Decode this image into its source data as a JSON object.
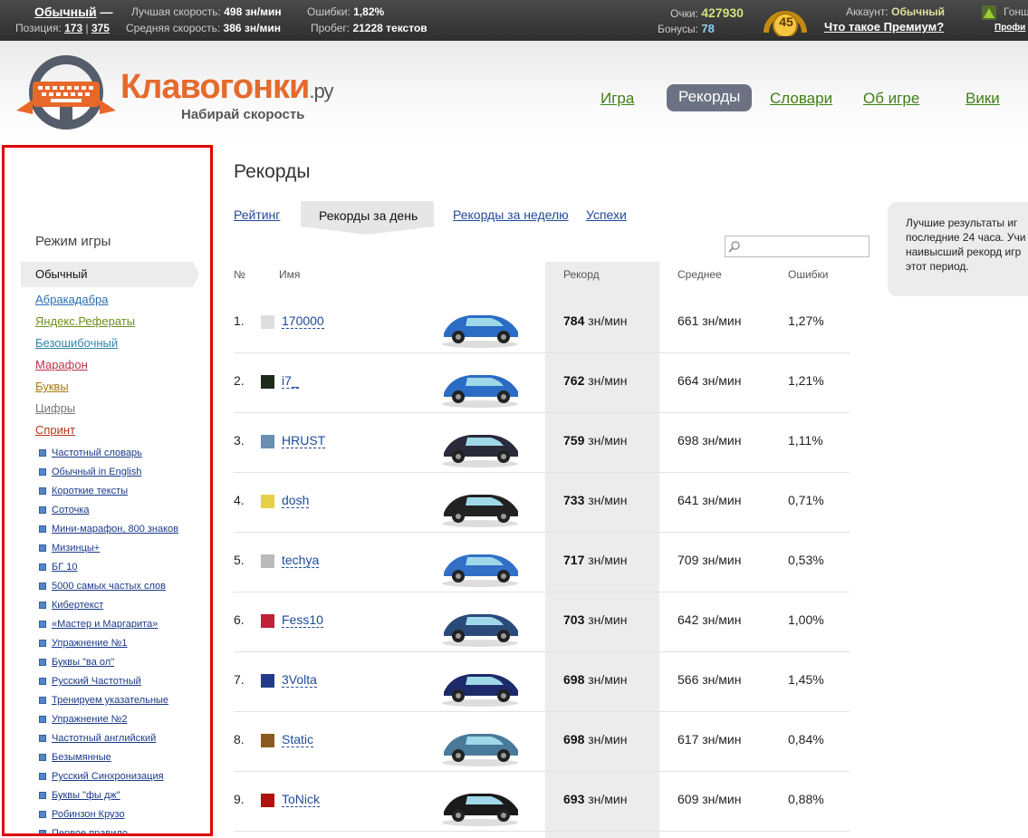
{
  "topbar": {
    "mode": "Обычный",
    "mode_dash": "—",
    "position_label": "Позиция:",
    "position_value": "173",
    "position_total": "375",
    "best_speed_label": "Лучшая скорость:",
    "best_speed_value": "498 зн/мин",
    "avg_speed_label": "Средняя скорость:",
    "avg_speed_value": "386 зн/мин",
    "errors_label": "Ошибки:",
    "errors_value": "1,82%",
    "mileage_label": "Пробег:",
    "mileage_value": "21228 текстов",
    "points_label": "Очки:",
    "points_value": "427930",
    "bonus_label": "Бонусы:",
    "bonus_value": "78",
    "level": "45",
    "account_label": "Аккаунт:",
    "account_value": "Обычный",
    "premium_link": "Что такое Премиум?",
    "user_short": "Гонщ",
    "profile_short": "Профи"
  },
  "header": {
    "brand": "Клавогонки",
    "brand_suffix": ".ру",
    "slogan": "Набирай скорость",
    "nav": [
      "Игра",
      "Рекорды",
      "Словари",
      "Об игре",
      "Вики"
    ],
    "active_nav": "Рекорды"
  },
  "sidebar": {
    "title": "Режим игры",
    "active": "Обычный",
    "modes": [
      {
        "label": "Абракадабра",
        "color": "#2a6fb0"
      },
      {
        "label": "Яндекс.Рефераты",
        "color": "#6f8f1e"
      },
      {
        "label": "Безошибочный",
        "color": "#2f86a8"
      },
      {
        "label": "Марафон",
        "color": "#c0304a"
      },
      {
        "label": "Буквы",
        "color": "#a87a10"
      },
      {
        "label": "Цифры",
        "color": "#777777"
      },
      {
        "label": "Спринт",
        "color": "#b23a1a"
      }
    ],
    "sub": [
      "Частотный словарь",
      "Обычный in English",
      "Короткие тексты",
      "Соточка",
      "Мини-марафон, 800 знаков",
      "Мизинцы+",
      "БГ 10",
      "5000 самых частых слов",
      "Кибертекст",
      "«Мастер и Маргарита»",
      "Упражнение №1",
      "Буквы \"ва ол\"",
      "Русский Частотный",
      "Тренируем указательные",
      "Упражнение №2",
      "Частотный английский",
      "Безымянные",
      "Русский Синхронизация",
      "Буквы \"фы дж\"",
      "Робинзон Крузо",
      "Первое правило"
    ]
  },
  "main": {
    "title": "Рекорды",
    "tabs": [
      "Рейтинг",
      "Рекорды за день",
      "Рекорды за неделю",
      "Успехи"
    ],
    "active_tab": "Рекорды за день",
    "columns": {
      "num": "№",
      "name": "Имя",
      "record": "Рекорд",
      "avg": "Среднее",
      "errors": "Ошибки"
    },
    "unit": "зн/мин",
    "rows": [
      {
        "num": "1.",
        "name": "170000",
        "record": "784",
        "avg": "661 зн/мин",
        "errors": "1,27%"
      },
      {
        "num": "2.",
        "name": "i7_",
        "record": "762",
        "avg": "664 зн/мин",
        "errors": "1,21%"
      },
      {
        "num": "3.",
        "name": "HRUST",
        "record": "759",
        "avg": "698 зн/мин",
        "errors": "1,11%"
      },
      {
        "num": "4.",
        "name": "dosh",
        "record": "733",
        "avg": "641 зн/мин",
        "errors": "0,71%"
      },
      {
        "num": "5.",
        "name": "techya",
        "record": "717",
        "avg": "709 зн/мин",
        "errors": "0,53%"
      },
      {
        "num": "6.",
        "name": "Fess10",
        "record": "703",
        "avg": "642 зн/мин",
        "errors": "1,00%"
      },
      {
        "num": "7.",
        "name": "3Volta",
        "record": "698",
        "avg": "566 зн/мин",
        "errors": "1,45%"
      },
      {
        "num": "8.",
        "name": "Static",
        "record": "698",
        "avg": "617 зн/мин",
        "errors": "0,84%"
      },
      {
        "num": "9.",
        "name": "ToNick",
        "record": "693",
        "avg": "609 зн/мин",
        "errors": "0,88%"
      }
    ],
    "info": "Лучшие результаты иг последние 24 часа. Учи наивысший рекорд игр этот период."
  }
}
